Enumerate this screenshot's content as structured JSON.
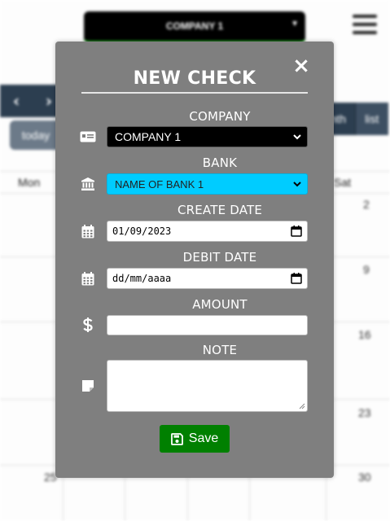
{
  "background": {
    "company_select": "COMPANY 1",
    "nav_prev": "‹",
    "nav_next": "›",
    "today_label": "today",
    "view_buttons": [
      "nth",
      "list"
    ],
    "weekday_headers": {
      "mon": "Mon",
      "sat": "Sat"
    },
    "day_numbers": [
      "2",
      "9",
      "16",
      "23",
      "30",
      "25"
    ]
  },
  "modal": {
    "title": "NEW CHECK",
    "close_icon": "×",
    "company_label": "COMPANY",
    "company_value": "COMPANY 1",
    "bank_label": "BANK",
    "bank_value": "NAME OF BANK 1",
    "create_date_label": "CREATE DATE",
    "create_date_value": "01/09/2023",
    "debit_date_label": "DEBIT DATE",
    "debit_date_placeholder": "dd/mm/aaaa",
    "amount_label": "AMOUNT",
    "amount_value": "",
    "note_label": "NOTE",
    "note_value": "",
    "save_label": "Save"
  },
  "colors": {
    "modal_bg": "#7f7f7f",
    "company_select_bg": "#000000",
    "bank_select_bg": "#00ccff",
    "save_button_bg": "#008000"
  },
  "icons": {
    "company": "id-card-icon",
    "bank": "bank-building-icon",
    "create_date": "calendar-icon",
    "debit_date": "calendar-icon",
    "amount": "dollar-icon",
    "note": "sticky-note-icon",
    "save": "floppy-disk-icon",
    "menu": "hamburger-menu-icon"
  }
}
